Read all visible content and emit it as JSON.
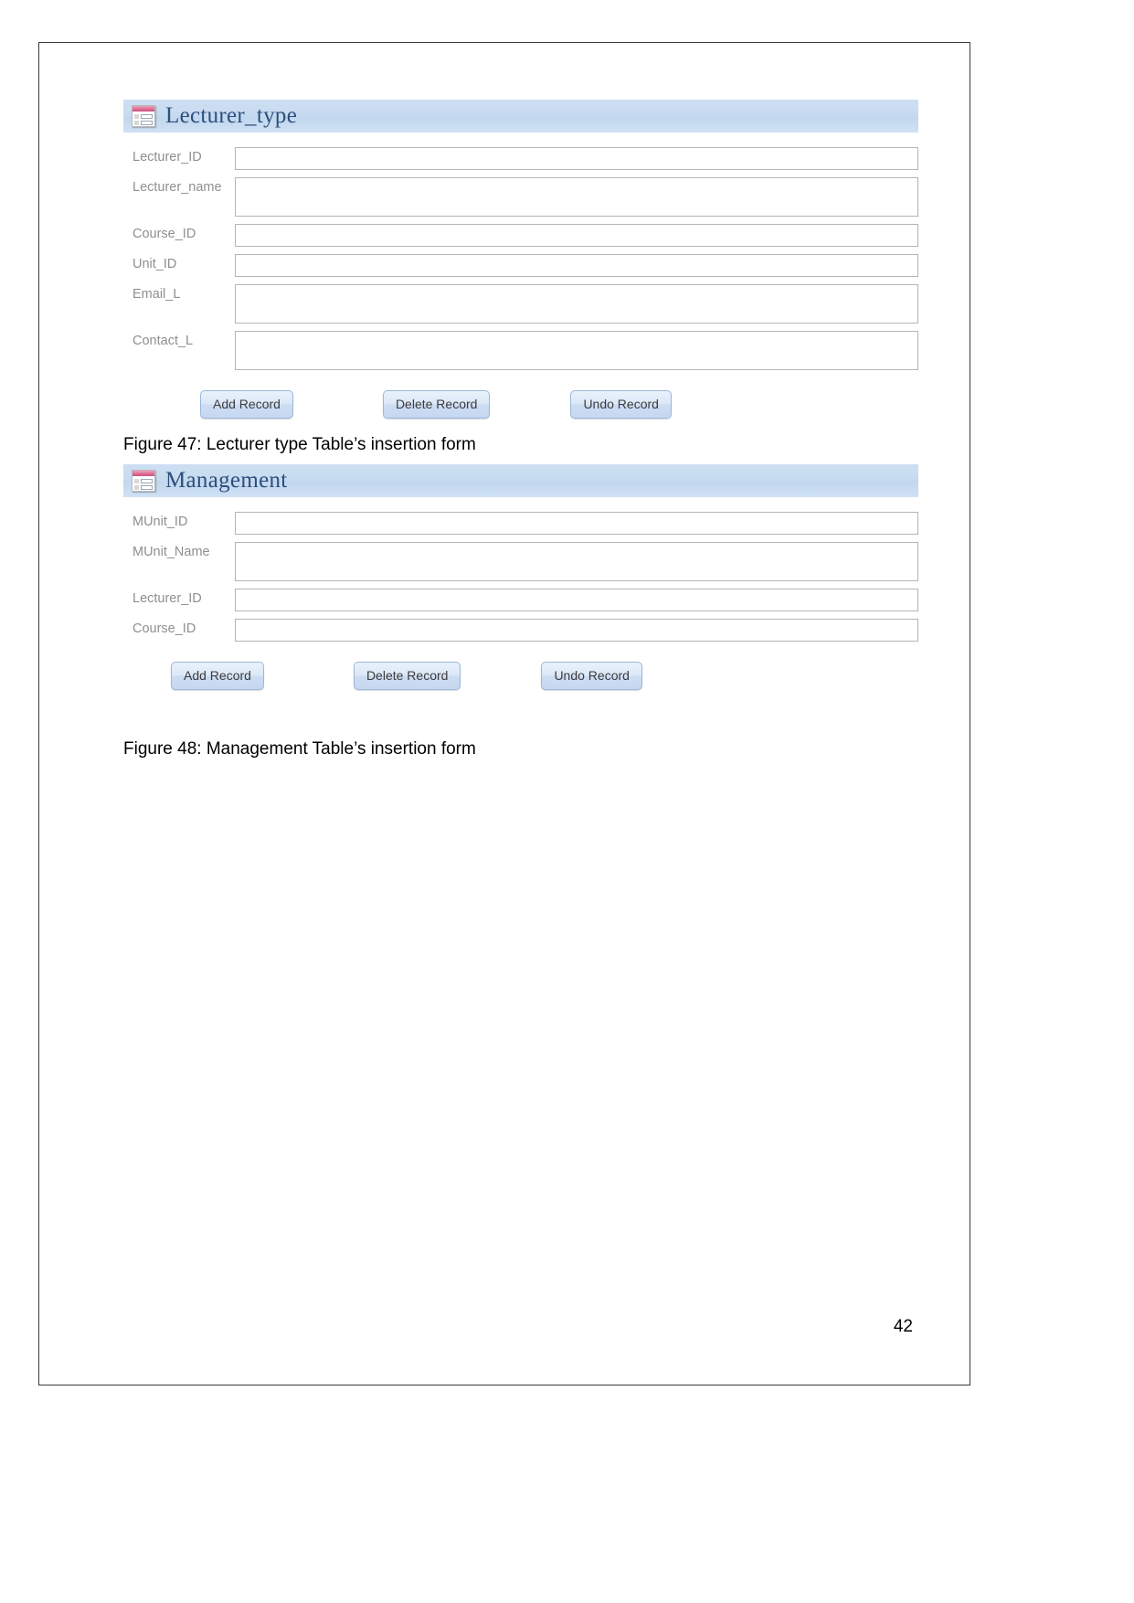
{
  "page": {
    "number": "42"
  },
  "forms": [
    {
      "icon": "access-form-icon",
      "title": "Lecturer_type",
      "fields": [
        {
          "label": "Lecturer_ID",
          "value": "",
          "size": "sm"
        },
        {
          "label": "Lecturer_name",
          "value": "",
          "size": "md"
        },
        {
          "label": "Course_ID",
          "value": "",
          "size": "sm"
        },
        {
          "label": "Unit_ID",
          "value": "",
          "size": "sm"
        },
        {
          "label": "Email_L",
          "value": "",
          "size": "md"
        },
        {
          "label": "Contact_L",
          "value": "",
          "size": "md"
        }
      ],
      "buttons": [
        {
          "label": "Add Record"
        },
        {
          "label": "Delete Record"
        },
        {
          "label": "Undo Record"
        }
      ],
      "caption": "Figure 47: Lecturer type Table’s insertion form"
    },
    {
      "icon": "access-form-icon",
      "title": "Management",
      "fields": [
        {
          "label": "MUnit_ID",
          "value": "",
          "size": "sm"
        },
        {
          "label": "MUnit_Name",
          "value": "",
          "size": "md"
        },
        {
          "label": "Lecturer_ID",
          "value": "",
          "size": "sm"
        },
        {
          "label": "Course_ID",
          "value": "",
          "size": "sm"
        }
      ],
      "buttons": [
        {
          "label": "Add Record"
        },
        {
          "label": "Delete Record"
        },
        {
          "label": "Undo Record"
        }
      ],
      "caption": "Figure 48: Management Table’s insertion form"
    }
  ],
  "colors": {
    "header_band": "#c7dbf0",
    "title_text": "#2d4f7c",
    "label_text": "#8f8f8f",
    "button_face": "#d6e4f6",
    "button_border": "#9db8d8",
    "icon_accent": "#d9628c"
  }
}
